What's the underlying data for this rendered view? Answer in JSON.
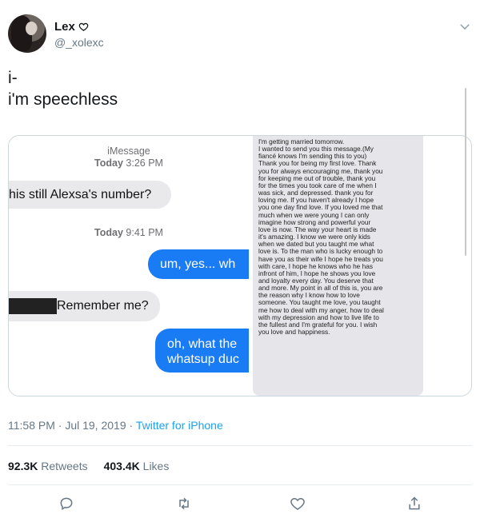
{
  "user": {
    "display_name": "Lex",
    "handle": "@_xolexc"
  },
  "tweet": {
    "lines": [
      "i-",
      "i'm speechless"
    ]
  },
  "media": {
    "imessage_label": "iMessage",
    "first_timestamp_day": "Today",
    "first_timestamp_time": "3:26 PM",
    "bubble_1": "his still Alexsa's number?",
    "second_timestamp_day": "Today",
    "second_timestamp_time": "9:41 PM",
    "bubble_2": "um, yes... wh",
    "bubble_3": "Remember me?",
    "bubble_4_line1": "oh, what the",
    "bubble_4_line2": "whatsup duc",
    "letter_lines": [
      "I'm getting married tomorrow.",
      "I wanted to send you this message.(My",
      "fiancé knows I'm sending this to you)",
      "Thank you for being my first love. Thank",
      "you for always encouraging me, thank you",
      "for keeping me out of trouble, thank you",
      "for the times you took care of me when I",
      "was sick, and depressed. thank you for",
      "loving me. If you haven't already I hope",
      "you one day find love. If you loved me that",
      "much when we were young I can only",
      "imagine how strong and powerful your",
      "love is now. The way your heart is made",
      "it's amazing. I know we were only kids",
      "when we dated but you taught me what",
      "love is. To the man who is lucky enough to",
      "have you as their wife I hope he treats you",
      "with care, I hope he knows who he has",
      "infront of him, I hope he shows you love",
      "and loyalty every day. You deserve that",
      "and more. My point in all of this is, you are",
      "the reason why I know how to love",
      "someone. You taught me love, you taught",
      "me how to deal with my anger, how to deal",
      "with my depression and how to live life to",
      "the fullest and I'm grateful for you. I wish",
      "you love and happiness."
    ]
  },
  "meta": {
    "time": "11:58 PM · Jul 19, 2019",
    "separator": " · ",
    "source": "Twitter for iPhone"
  },
  "stats": {
    "retweets_count": "92.3K",
    "retweets_label": "Retweets",
    "likes_count": "403.4K",
    "likes_label": "Likes"
  },
  "icons": {
    "verified_heart": "heart-outline-icon",
    "caret": "chevron-down-icon",
    "reply": "reply-icon",
    "retweet": "retweet-icon",
    "like": "heart-icon",
    "share": "share-icon"
  },
  "colors": {
    "link": "#1da1f2",
    "secondary": "#657786",
    "imessage_blue": "#1a7cf5",
    "imessage_gray": "#e9e9eb"
  }
}
